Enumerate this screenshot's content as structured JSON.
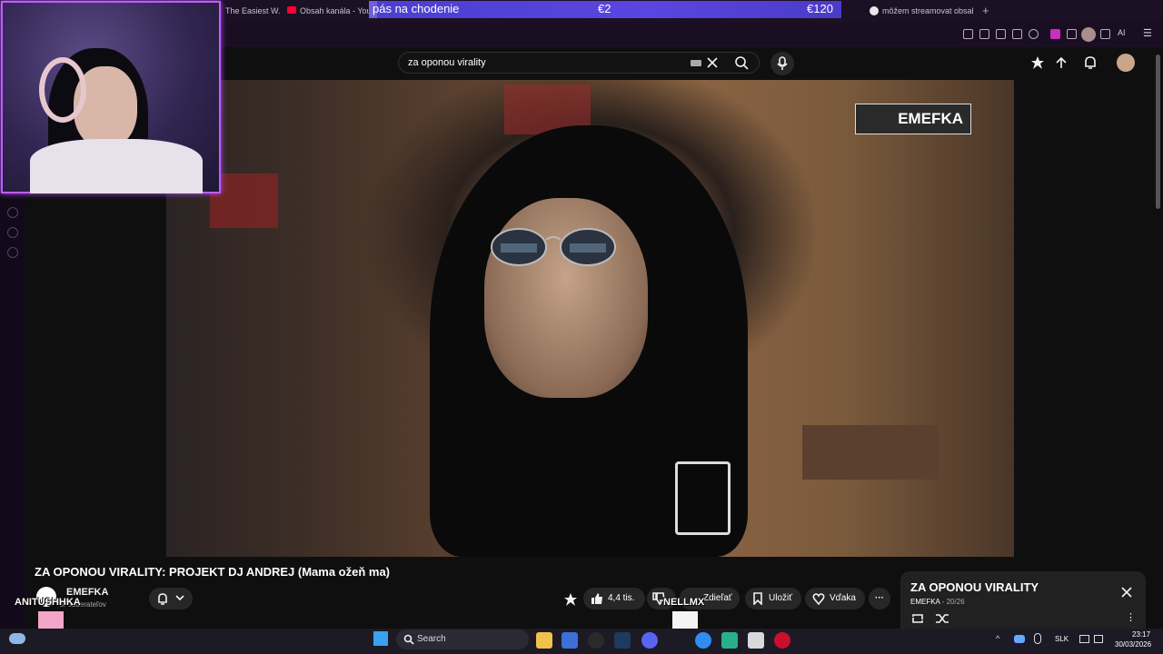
{
  "browser": {
    "tabs": [
      {
        "label": "The Easiest W..."
      },
      {
        "label": "Obsah kanála - You"
      },
      {
        "label": "môžem streamovat obsah"
      }
    ],
    "new_tab_icon": "plus-icon",
    "toolbar_right_label": "AI"
  },
  "overlay": {
    "goal_text": "pás na chodenie",
    "current_amount": "€2",
    "target_amount": "€120",
    "goal_progress": 0.017,
    "viewer_names": [
      "ANITUSHHKA",
      "NELLMX"
    ]
  },
  "youtube": {
    "search": {
      "value": "za oponou virality"
    },
    "watermark": "EMEFKA",
    "video_title": "ZA OPONOU VIRALITY: PROJEKT DJ ANDREJ (Mama ožeň ma)",
    "channel": {
      "name": "EMEFKA",
      "subscribers": "s. odberateľov"
    },
    "actions": {
      "likes": "4,4 tis.",
      "share": "Zdieľať",
      "save": "Uložiť",
      "thanks": "Vďaka"
    },
    "playlist": {
      "title": "ZA OPONOU VIRALITY",
      "channel": "EMEFKA",
      "position": "20/26"
    }
  },
  "taskbar": {
    "search_label": "Search",
    "language": "SLK",
    "time": "23:17",
    "date": "30/03/2026"
  },
  "colors": {
    "accent_purple": "#c05cff",
    "goal_bar": "#4b3fd0",
    "yt_background": "#0f0f0f"
  }
}
